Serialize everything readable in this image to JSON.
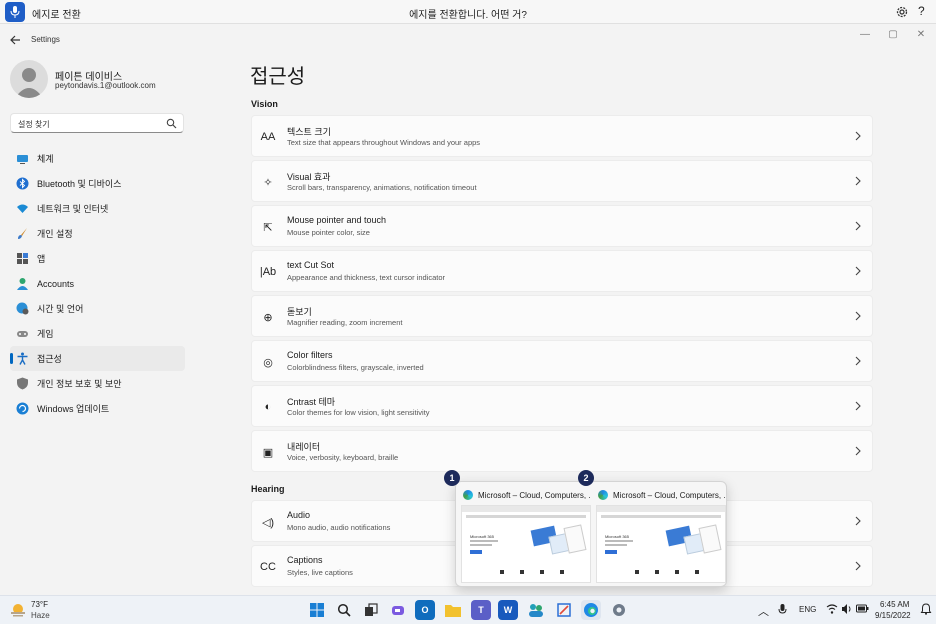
{
  "voice_bar": {
    "status": "에지로 전환",
    "hint": "에지를 전환합니다. 어떤 거?",
    "settings_icon": "gear-icon",
    "help": "?"
  },
  "window": {
    "title": "Settings",
    "back_icon": "arrow-left-icon",
    "minimize": "—",
    "maximize": "▢",
    "close": "✕"
  },
  "user": {
    "name": "페이튼 데이비스",
    "email": "peytondavis.1@outlook.com"
  },
  "search": {
    "value": "설정 찾기"
  },
  "sidebar": {
    "items": [
      {
        "label": "체계",
        "icon": "monitor-icon"
      },
      {
        "label": "Bluetooth 및 디바이스",
        "icon": "bluetooth-icon"
      },
      {
        "label": "네트워크 및 인터넷",
        "icon": "wifi-icon"
      },
      {
        "label": "개인 설정",
        "icon": "brush-icon"
      },
      {
        "label": "앱",
        "icon": "apps-icon"
      },
      {
        "label": "Accounts",
        "icon": "person-icon"
      },
      {
        "label": "시간 및 언어",
        "icon": "globe-clock-icon"
      },
      {
        "label": "게임",
        "icon": "gamepad-icon"
      },
      {
        "label": "접근성",
        "icon": "accessibility-icon",
        "active": true
      },
      {
        "label": "개인 정보 보호 및 보안",
        "icon": "shield-icon"
      },
      {
        "label": "Windows 업데이트",
        "icon": "update-icon"
      }
    ]
  },
  "main": {
    "title": "접근성",
    "vision_heading": "Vision",
    "hearing_heading": "Hearing",
    "cards": [
      {
        "icon_glyph": "AA",
        "icon": "text-size-icon",
        "title": "텍스트 크기",
        "subtitle": "Text size that appears throughout Windows and your apps"
      },
      {
        "icon_glyph": "✧",
        "icon": "visual-effects-icon",
        "title": "Visual 효과",
        "subtitle": "Scroll bars, transparency, animations, notification timeout"
      },
      {
        "icon_glyph": "⇱",
        "icon": "mouse-pointer-icon",
        "title": "Mouse pointer and touch",
        "subtitle": "Mouse pointer color, size"
      },
      {
        "icon_glyph": "|Ab",
        "icon": "text-cursor-icon",
        "title": "text Cut Sot",
        "subtitle": "Appearance and thickness, text cursor indicator"
      },
      {
        "icon_glyph": "⊕",
        "icon": "magnifier-icon",
        "title": "돋보기",
        "subtitle": "Magnifier reading, zoom increment"
      },
      {
        "icon_glyph": "◎",
        "icon": "color-filters-icon",
        "title": "Color filters",
        "subtitle": "Colorblindness filters, grayscale, inverted"
      },
      {
        "icon_glyph": "◐",
        "icon": "contrast-icon",
        "title": "Cntrast 테마",
        "subtitle": "Color themes for low vision, light sensitivity"
      },
      {
        "icon_glyph": "▣",
        "icon": "narrator-icon",
        "title": "내레이터",
        "subtitle": "Voice, verbosity, keyboard, braille"
      },
      {
        "icon_glyph": "◁)",
        "icon": "audio-icon",
        "title": "Audio",
        "subtitle": "Mono audio, audio notifications"
      },
      {
        "icon_glyph": "CC",
        "icon": "captions-icon",
        "title": "Captions",
        "subtitle": "Styles, live captions"
      }
    ]
  },
  "popup": {
    "thumbs": [
      {
        "number": "1",
        "title": "Microsoft – Cloud, Computers, ..."
      },
      {
        "number": "2",
        "title": "Microsoft – Cloud, Computers, ..."
      }
    ],
    "thumb_heading": "Microsoft 365"
  },
  "taskbar": {
    "weather_temp": "73°F",
    "weather_cond": "Haze",
    "lang": "ENG",
    "time": "6:45 AM",
    "date": "9/15/2022",
    "apps": [
      {
        "name": "start-icon"
      },
      {
        "name": "search-icon"
      },
      {
        "name": "task-view-icon"
      },
      {
        "name": "chat-icon"
      },
      {
        "name": "outlook-icon",
        "glyph": "O"
      },
      {
        "name": "file-explorer-icon"
      },
      {
        "name": "teams-icon",
        "glyph": "T"
      },
      {
        "name": "word-icon",
        "glyph": "W"
      },
      {
        "name": "people-icon"
      },
      {
        "name": "snipping-tool-icon"
      },
      {
        "name": "edge-icon"
      },
      {
        "name": "settings-icon"
      }
    ]
  },
  "colors": {
    "accent": "#0067c0",
    "mic": "#1f5ec7",
    "badge": "#1d2a5b"
  }
}
